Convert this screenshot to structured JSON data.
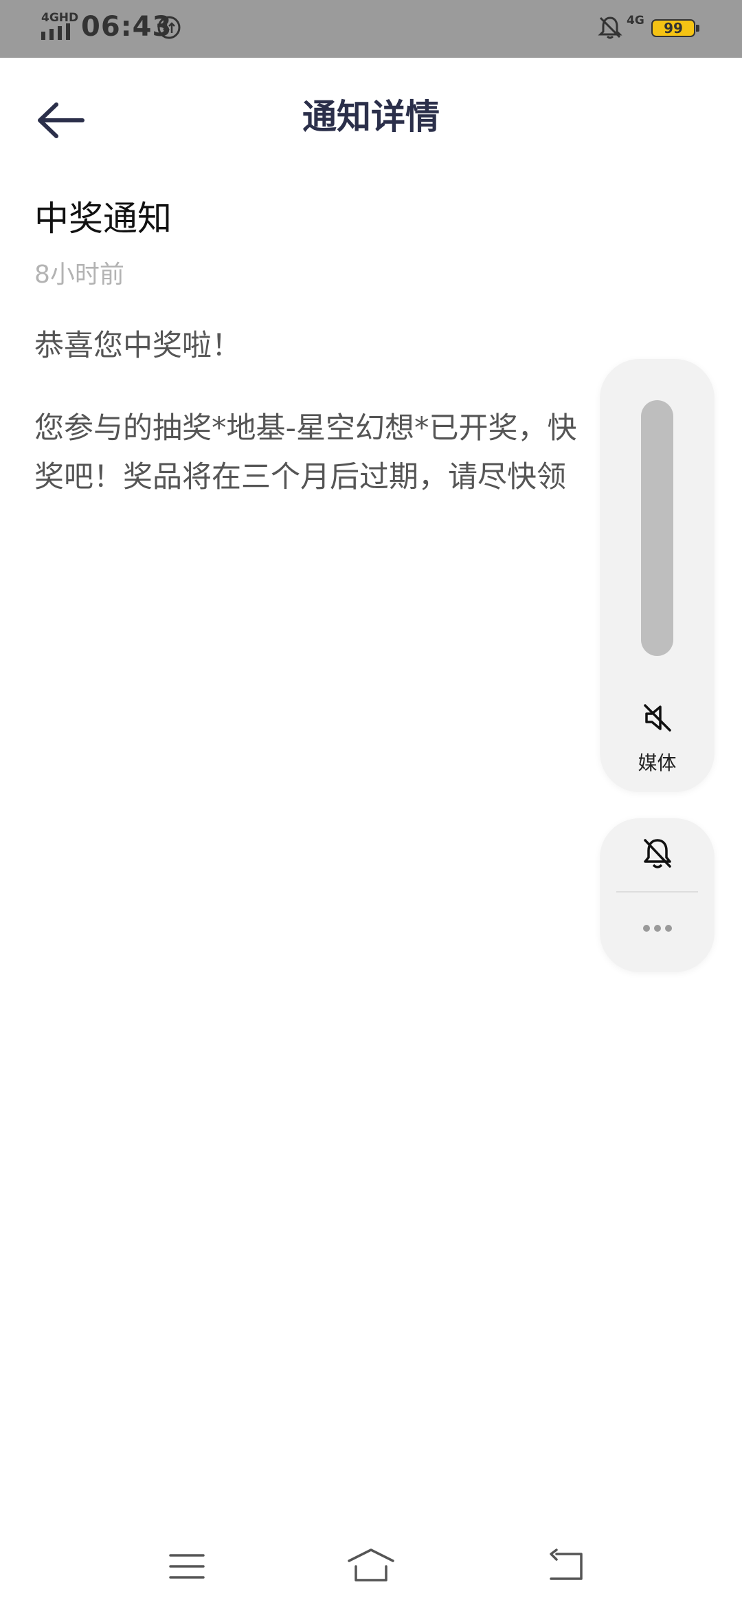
{
  "status_bar": {
    "network_label": "4GHD",
    "time": "06:43",
    "network_label_right": "4G",
    "battery_level": "99",
    "icons": [
      "signal-icon",
      "data-saver-icon",
      "bell-off-icon",
      "battery-icon"
    ]
  },
  "header": {
    "title": "通知详情",
    "back_icon": "arrow-left-icon"
  },
  "notice": {
    "title": "中奖通知",
    "time": "8小时前",
    "greeting": "恭喜您中奖啦！",
    "body": "您参与的抽奖*地基-星空幻想*已开奖，快\n奖吧！奖品将在三个月后过期，请尽快领"
  },
  "volume_overlay": {
    "media_label": "媒体",
    "media_icon": "speaker-mute-icon",
    "ring_icon": "bell-off-icon",
    "more_icon": "more-dots-icon",
    "media_level": 0
  },
  "nav_bar": {
    "icons": [
      "menu-icon",
      "home-icon",
      "back-icon"
    ]
  }
}
